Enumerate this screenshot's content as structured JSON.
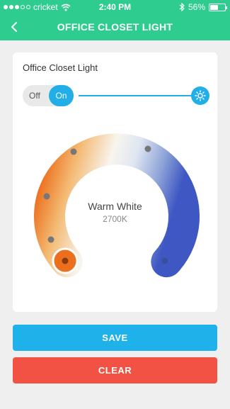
{
  "status_bar": {
    "carrier": "cricket",
    "time": "2:40 PM",
    "battery": "56%",
    "battery_level": 0.56,
    "icons": [
      "signal-dots-icon",
      "wifi-icon",
      "bluetooth-icon",
      "battery-icon"
    ]
  },
  "nav": {
    "title": "OFFICE CLOSET LIGHT",
    "back_icon": "chevron-left-icon"
  },
  "device": {
    "label": "Office Closet Light",
    "toggle": {
      "off_label": "Off",
      "on_label": "On",
      "state": "on"
    },
    "brightness_icon": "sun-icon",
    "brightness_fraction": 1.0
  },
  "color_temperature": {
    "name": "Warm White",
    "value": "2700K",
    "selected_preset_index": 0
  },
  "actions": {
    "save_label": "SAVE",
    "clear_label": "CLEAR"
  },
  "colors": {
    "accent_green": "#2ecc8f",
    "accent_blue": "#22aee6",
    "clear_red": "#f15244",
    "warm": "#ec6f1e",
    "cool": "#3f57c2"
  }
}
